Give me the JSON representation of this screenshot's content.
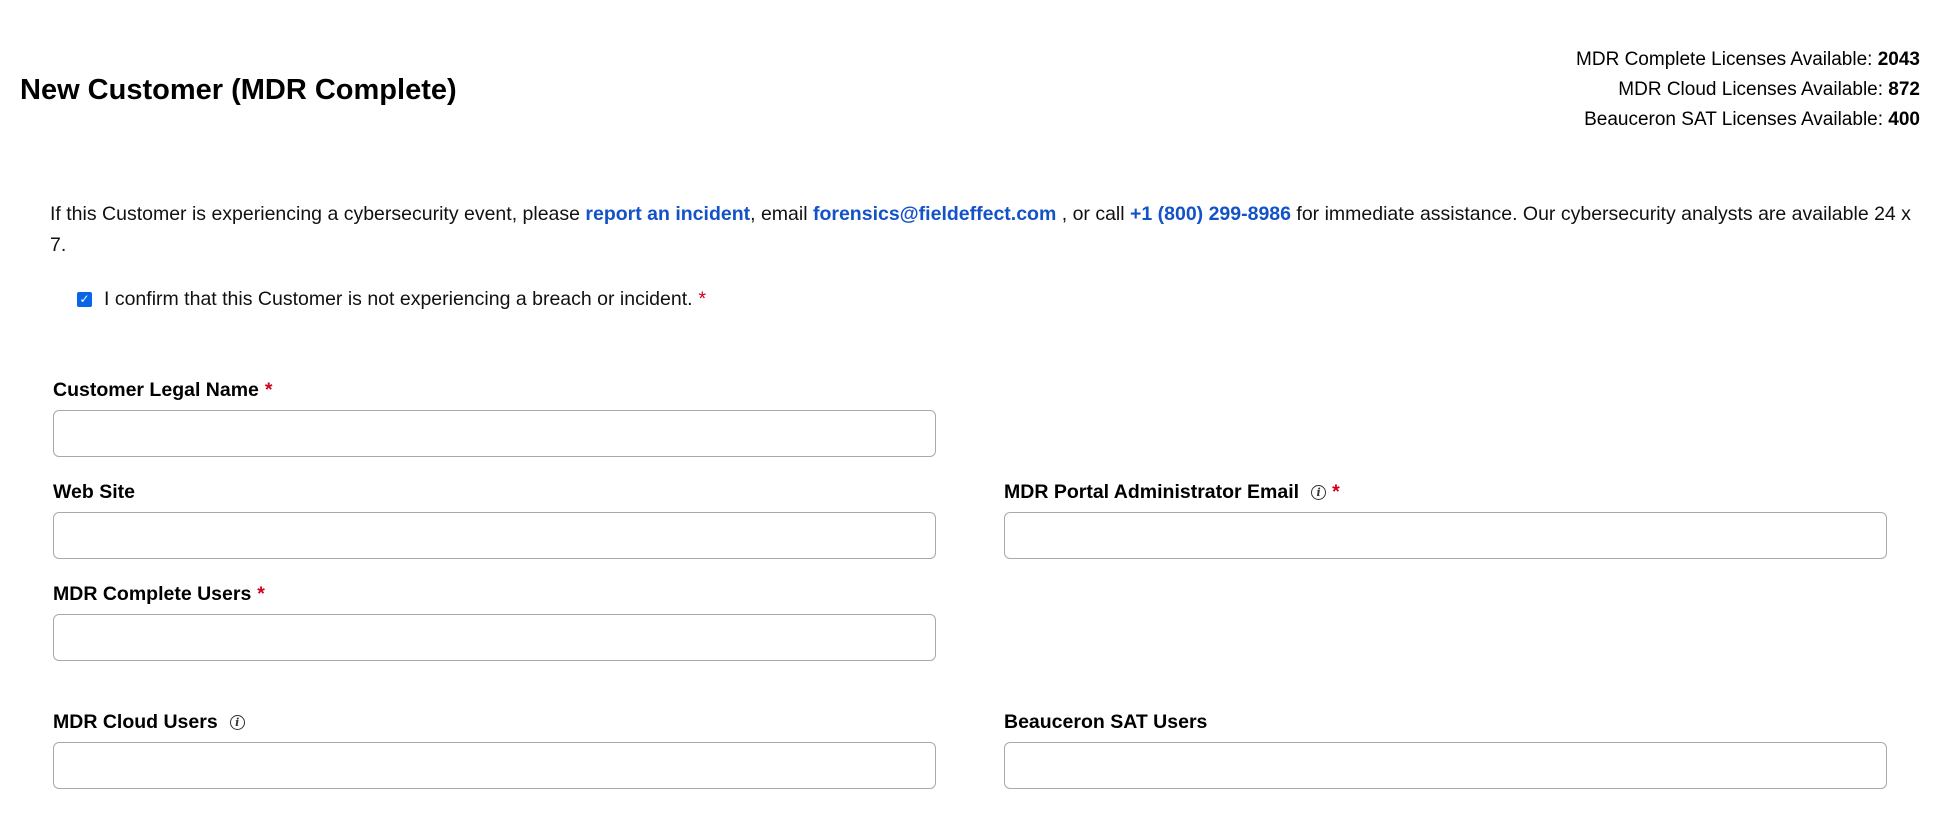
{
  "page": {
    "title": "New Customer (MDR Complete)"
  },
  "licenses": [
    {
      "label": "MDR Complete Licenses Available: ",
      "value": "2043"
    },
    {
      "label": "MDR Cloud Licenses Available: ",
      "value": "872"
    },
    {
      "label": "Beauceron SAT Licenses Available: ",
      "value": "400"
    }
  ],
  "notice": {
    "part1": "If this Customer is experiencing a cybersecurity event, please ",
    "link_report": "report an incident",
    "part2": ", email ",
    "link_email": "forensics@fieldeffect.com",
    "part3": " , or call ",
    "link_phone": "+1 (800) 299-8986",
    "part4": " for immediate assistance. Our cybersecurity analysts are available 24 x 7."
  },
  "confirm": {
    "label": "I confirm that this Customer is not experiencing a breach or incident.",
    "checked": true,
    "required_mark": "*"
  },
  "form": {
    "legal_name": {
      "label": "Customer Legal Name",
      "required_mark": "*",
      "value": ""
    },
    "web_site": {
      "label": "Web Site",
      "value": ""
    },
    "admin_email": {
      "label": "MDR Portal Administrator Email",
      "required_mark": "*",
      "value": ""
    },
    "complete_users": {
      "label": "MDR Complete Users",
      "required_mark": "*",
      "value": ""
    },
    "cloud_users": {
      "label": "MDR Cloud Users",
      "value": ""
    },
    "beauceron_users": {
      "label": "Beauceron SAT Users",
      "value": ""
    }
  },
  "colors": {
    "link": "#1452c8",
    "required": "#d0021b",
    "checkbox": "#0b63e5"
  },
  "icons": {
    "info": "info-icon",
    "checkbox": "checkmark-icon"
  }
}
